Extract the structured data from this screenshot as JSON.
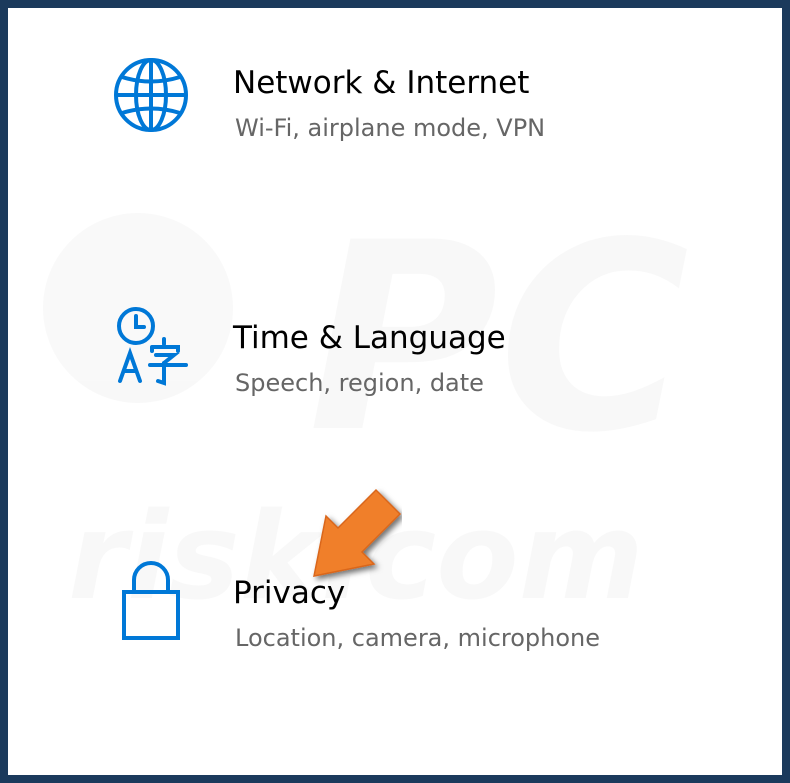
{
  "settings": {
    "items": [
      {
        "icon": "globe-icon",
        "title": "Network & Internet",
        "subtitle": "Wi-Fi, airplane mode, VPN"
      },
      {
        "icon": "time-language-icon",
        "title": "Time & Language",
        "subtitle": "Speech, region, date"
      },
      {
        "icon": "lock-icon",
        "title": "Privacy",
        "subtitle": "Location, camera, microphone"
      }
    ]
  },
  "colors": {
    "accent": "#0078d7",
    "arrow": "#f07f2a",
    "frame_border": "#1b3a5c"
  },
  "annotation": {
    "type": "arrow",
    "icon": "pointer-arrow-icon",
    "target": "Privacy"
  }
}
